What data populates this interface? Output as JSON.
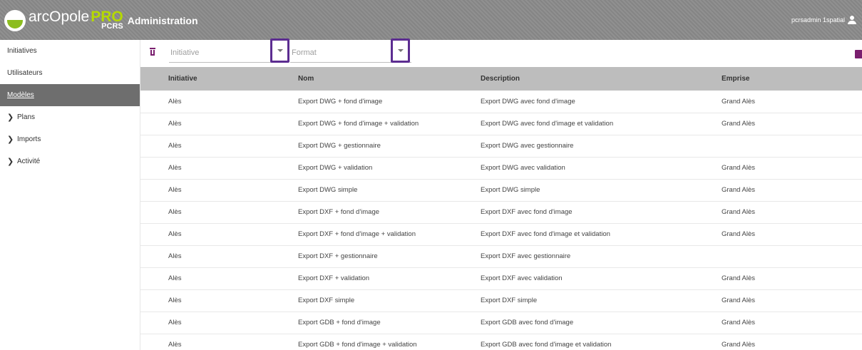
{
  "header": {
    "logo_main": "arcOpole",
    "logo_pro": "PRO",
    "logo_sub": "PCRS",
    "app_title": "Administration",
    "user_name": "pcrsadmin 1spatial",
    "user_icon": "person-icon"
  },
  "colors": {
    "header_bg": "#8a8a8a",
    "accent": "#7a1e6e",
    "highlight": "#5c2d91",
    "active_nav": "#6e6e6e",
    "table_header": "#bdbdbd"
  },
  "sidebar": {
    "items": [
      {
        "label": "Initiatives"
      },
      {
        "label": "Utilisateurs"
      },
      {
        "label": "Modèles"
      },
      {
        "label": "Plans"
      },
      {
        "label": "Imports"
      },
      {
        "label": "Activité"
      }
    ]
  },
  "filters": {
    "initiative_placeholder": "Initiative",
    "format_placeholder": "Format"
  },
  "table": {
    "headers": [
      "Initiative",
      "Nom",
      "Description",
      "Emprise"
    ],
    "rows": [
      [
        "Alès",
        "Export DWG + fond d'image",
        "Export DWG avec fond d'image",
        "Grand Alès"
      ],
      [
        "Alès",
        "Export DWG + fond d'image + validation",
        "Export DWG avec fond d'image et validation",
        "Grand Alès"
      ],
      [
        "Alès",
        "Export DWG + gestionnaire",
        "Export DWG avec gestionnaire",
        ""
      ],
      [
        "Alès",
        "Export DWG + validation",
        "Export DWG avec validation",
        "Grand Alès"
      ],
      [
        "Alès",
        "Export DWG simple",
        "Export DWG simple",
        "Grand Alès"
      ],
      [
        "Alès",
        "Export DXF + fond d'image",
        "Export DXF avec fond d'image",
        "Grand Alès"
      ],
      [
        "Alès",
        "Export DXF + fond d'image + validation",
        "Export DXF avec fond d'image et validation",
        "Grand Alès"
      ],
      [
        "Alès",
        "Export DXF + gestionnaire",
        "Export DXF avec gestionnaire",
        ""
      ],
      [
        "Alès",
        "Export DXF + validation",
        "Export DXF avec validation",
        "Grand Alès"
      ],
      [
        "Alès",
        "Export DXF simple",
        "Export DXF simple",
        "Grand Alès"
      ],
      [
        "Alès",
        "Export GDB + fond d'image",
        "Export GDB avec fond d'image",
        "Grand Alès"
      ],
      [
        "Alès",
        "Export GDB + fond d'image + validation",
        "Export GDB avec fond d'image et validation",
        "Grand Alès"
      ]
    ]
  }
}
